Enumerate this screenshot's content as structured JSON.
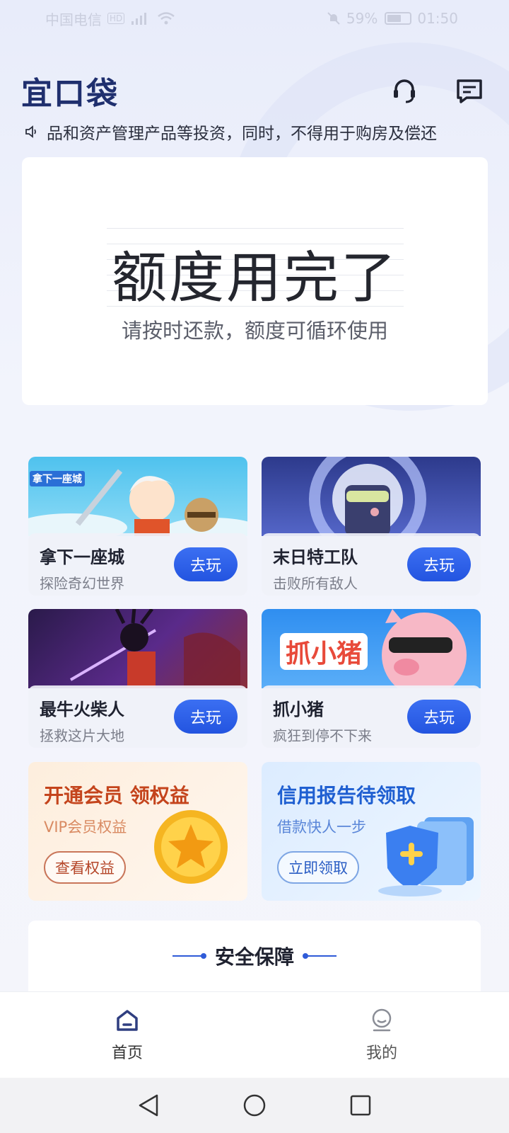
{
  "status_bar": {
    "carrier": "中国电信",
    "battery": "59%",
    "time": "01:50"
  },
  "header": {
    "logo": "宜口袋"
  },
  "notice": {
    "text": "品和资产管理产品等投资，同时，不得用于购房及偿还"
  },
  "quota": {
    "title": "额度用完了",
    "subtitle": "请按时还款，额度可循环使用"
  },
  "games": [
    {
      "name": "拿下一座城",
      "desc": "探险奇幻世界",
      "button": "去玩",
      "art_label": "拿下一座城"
    },
    {
      "name": "末日特工队",
      "desc": "击败所有敌人",
      "button": "去玩"
    },
    {
      "name": "最牛火柴人",
      "desc": "拯救这片大地",
      "button": "去玩"
    },
    {
      "name": "抓小猪",
      "desc": "疯狂到停不下来",
      "button": "去玩",
      "art_label": "抓小猪"
    }
  ],
  "promos": [
    {
      "title": "开通会员 领权益",
      "subtitle": "VIP会员权益",
      "button": "查看权益",
      "color": "#c4441c"
    },
    {
      "title": "信用报告待领取",
      "subtitle": "借款快人一步",
      "button": "立即领取",
      "color": "#1f5fd1"
    }
  ],
  "security": {
    "title": "安全保障"
  },
  "bottom_nav": [
    {
      "label": "首页",
      "icon": "home-icon",
      "active": true
    },
    {
      "label": "我的",
      "icon": "profile-icon",
      "active": false
    }
  ],
  "colors": {
    "brand_blue": "#2354e0",
    "logo_navy": "#1f2f6e"
  }
}
